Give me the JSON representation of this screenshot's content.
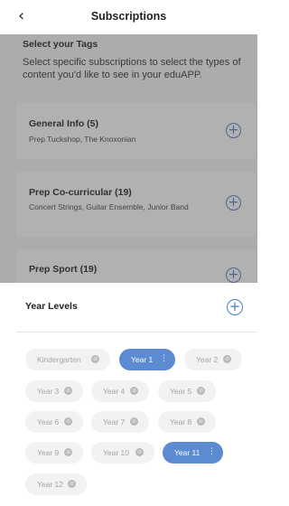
{
  "nav": {
    "back_icon": "chevron-left-icon",
    "back_glyph": "‹",
    "title": "Subscriptions"
  },
  "tags": {
    "title": "Select your Tags",
    "description": "Select specific subscriptions to select the types of content you'd like to see in your eduAPP."
  },
  "cards": [
    {
      "title": "General Info (5)",
      "subtitle": "Prep Tuckshop, The Knoxonian",
      "add_glyph": "+"
    },
    {
      "title": "Prep Co-curricular (19)",
      "subtitle": "Concert Strings, Guitar Ensemble, Junior Band",
      "add_glyph": "+"
    },
    {
      "title": "Prep Sport (19)",
      "subtitle": "",
      "add_glyph": "+"
    }
  ],
  "year_levels": {
    "title": "Year Levels",
    "add_glyph": "+",
    "unselected_glyph": "⊘",
    "selected_glyph": "⋮",
    "chips": [
      {
        "label": "Kindergarten",
        "selected": false
      },
      {
        "label": "Year 1",
        "selected": true
      },
      {
        "label": "Year 2",
        "selected": false
      },
      {
        "label": "Year 3",
        "selected": false
      },
      {
        "label": "Year 4",
        "selected": false
      },
      {
        "label": "Year 5",
        "selected": false
      },
      {
        "label": "Year 6",
        "selected": false
      },
      {
        "label": "Year 7",
        "selected": false
      },
      {
        "label": "Year 8",
        "selected": false
      },
      {
        "label": "Year 9",
        "selected": false
      },
      {
        "label": "Year 10",
        "selected": false
      },
      {
        "label": "Year 11",
        "selected": true
      },
      {
        "label": "Year 12",
        "selected": false
      }
    ]
  },
  "colors": {
    "accent": "#5d8bd1",
    "chip_bg": "#f2f2f2",
    "chip_text": "#a5a5a5"
  }
}
